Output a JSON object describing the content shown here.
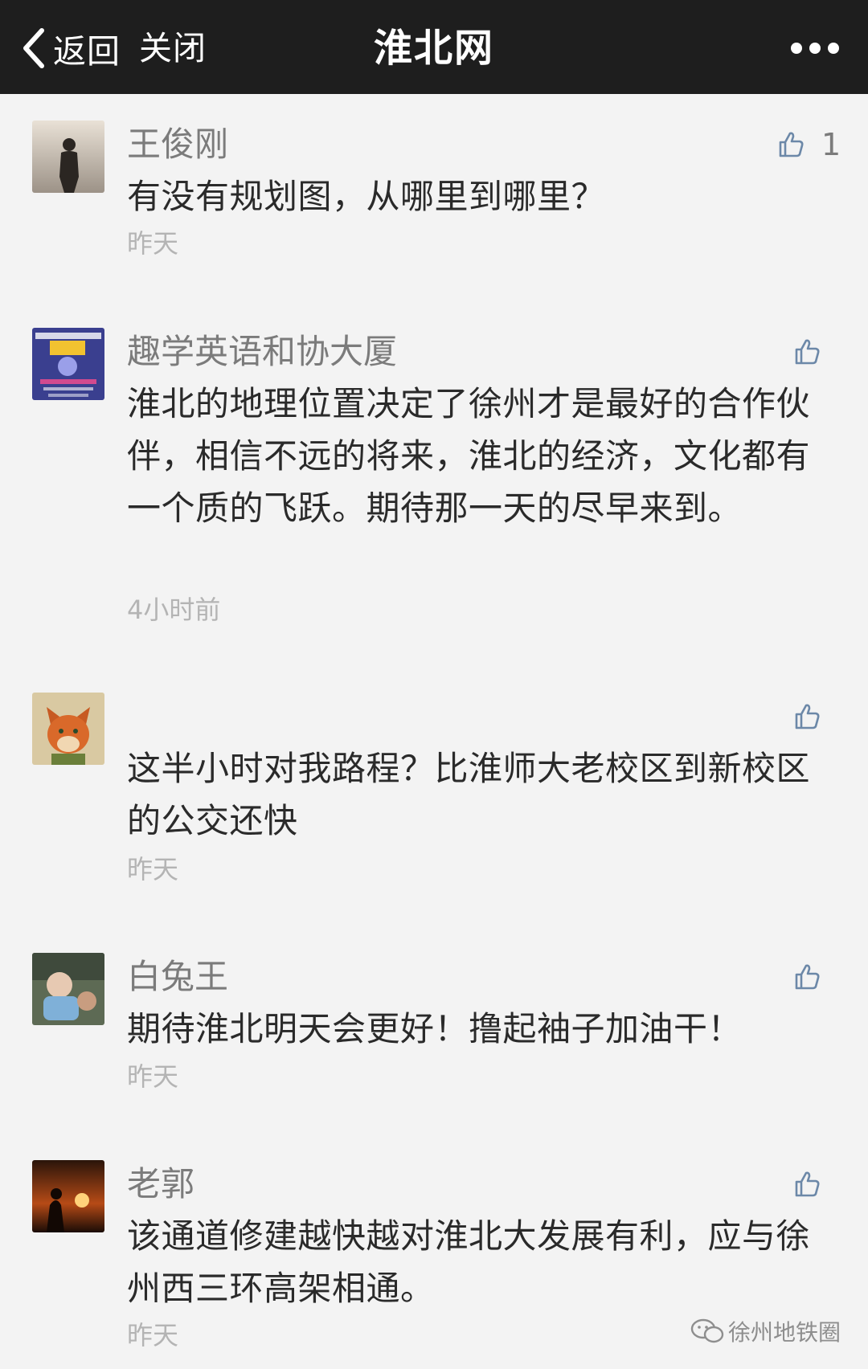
{
  "header": {
    "back_label": "返回",
    "close_label": "关闭",
    "title": "淮北网",
    "more_icon": "more-dots-icon"
  },
  "comments": [
    {
      "nickname": "王俊刚",
      "text": "有没有规划图，从哪里到哪里？",
      "time": "昨天",
      "likes": "1",
      "avatar_icon": "silhouette-avatar"
    },
    {
      "nickname": "趣学英语和协大厦",
      "text": "淮北的地理位置决定了徐州才是最好的合作伙伴，相信不远的将来，淮北的经济，文化都有一个质的飞跃。期待那一天的尽早来到。",
      "time": "4小时前",
      "likes": "",
      "avatar_icon": "poster-avatar"
    },
    {
      "nickname": "",
      "text": "这半小时对我路程？比淮师大老校区到新校区的公交还快",
      "time": "昨天",
      "likes": "",
      "avatar_icon": "fox-avatar"
    },
    {
      "nickname": "白兔王",
      "text": "期待淮北明天会更好！撸起袖子加油干！",
      "time": "昨天",
      "likes": "",
      "avatar_icon": "baby-avatar"
    },
    {
      "nickname": "老郭",
      "text": "该通道修建越快越对淮北大发展有利，应与徐州西三环高架相通。",
      "time": "昨天",
      "likes": "",
      "avatar_icon": "sunset-avatar"
    }
  ],
  "watermark": {
    "text": "徐州地铁圈"
  },
  "colors": {
    "header_bg": "#1e1e1e",
    "page_bg": "#f3f3f3",
    "icon": "#6c88a8"
  }
}
